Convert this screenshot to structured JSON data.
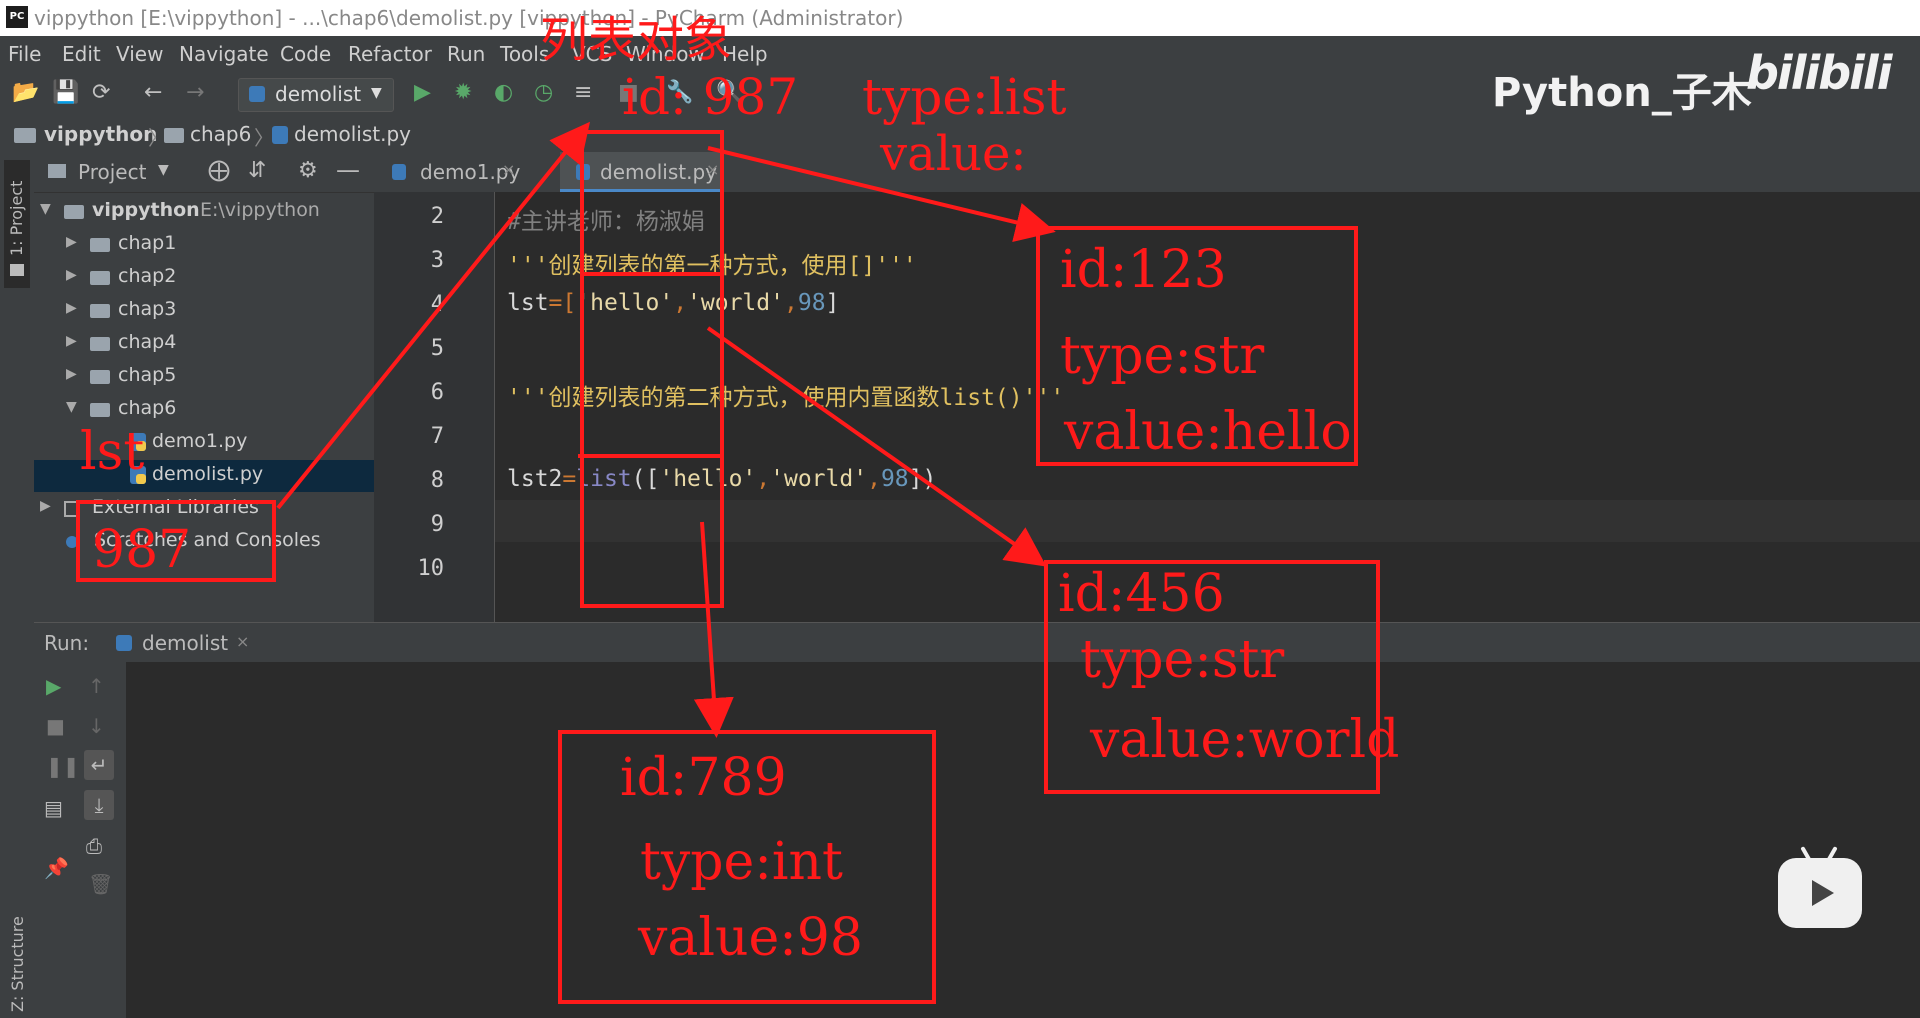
{
  "window": {
    "title": "vippython [E:\\vippython] - ...\\chap6\\demolist.py [vippython] - PyCharm (Administrator)",
    "app_icon": "PC"
  },
  "menu": [
    "File",
    "Edit",
    "View",
    "Navigate",
    "Code",
    "Refactor",
    "Run",
    "Tools",
    "VCS",
    "Window",
    "Help"
  ],
  "toolbar": {
    "run_config": "demolist"
  },
  "breadcrumb": [
    "vippython",
    "chap6",
    "demolist.py"
  ],
  "left_strip": {
    "project_tab": "1: Project",
    "structure_tab": "Z: Structure"
  },
  "project_panel": {
    "header": "Project",
    "tree": [
      {
        "label": "vippython",
        "extra": "E:\\vippython"
      },
      {
        "label": "chap1"
      },
      {
        "label": "chap2"
      },
      {
        "label": "chap3"
      },
      {
        "label": "chap4"
      },
      {
        "label": "chap5"
      },
      {
        "label": "chap6"
      },
      {
        "label": "demo1.py"
      },
      {
        "label": "demolist.py"
      },
      {
        "label": "External Libraries"
      },
      {
        "label": "Scratches and Consoles"
      }
    ]
  },
  "editor": {
    "tabs": [
      "demo1.py",
      "demolist.py"
    ],
    "line_numbers": [
      "2",
      "3",
      "4",
      "5",
      "6",
      "7",
      "8",
      "9",
      "10"
    ],
    "lines": {
      "l2": "#主讲老师：杨淑娟",
      "l3": "'''创建列表的第一种方式，使用[]'''",
      "l4_a": "lst",
      "l4_b": "=[",
      "l4_c": "'hello'",
      "l4_d": ",",
      "l4_e": "'world'",
      "l4_f": ",",
      "l4_g": "98",
      "l4_h": "]",
      "l6": "'''创建列表的第二种方式，使用内置函数list()'''",
      "l8_a": "lst2",
      "l8_b": "=",
      "l8_c": "list",
      "l8_d": "([",
      "l8_e": "'hello'",
      "l8_f": ",",
      "l8_g": "'world'",
      "l8_h": ",",
      "l8_i": "98",
      "l8_j": "])"
    }
  },
  "run_panel": {
    "label": "Run:",
    "tab": "demolist"
  },
  "watermark": {
    "channel": "Python_子木",
    "site": "bilibili"
  },
  "annotations": {
    "list_object_title": "列表对象",
    "list_id": "id: 987",
    "list_type": "type:list",
    "list_value": "value:",
    "var_name": "lst",
    "var_value": "987",
    "hello_id": "id:123",
    "hello_type": "type:str",
    "hello_value": "value:hello",
    "world_id": "id:456",
    "world_type": "type:str",
    "world_value": "value:world",
    "int_id": "id:789",
    "int_type": "type:int",
    "int_value": "value:98"
  },
  "colors": {
    "annotation": "#ff1a1a",
    "editor_bg": "#2b2b2b",
    "panel_bg": "#3c3f41",
    "selection": "#0d293e"
  }
}
